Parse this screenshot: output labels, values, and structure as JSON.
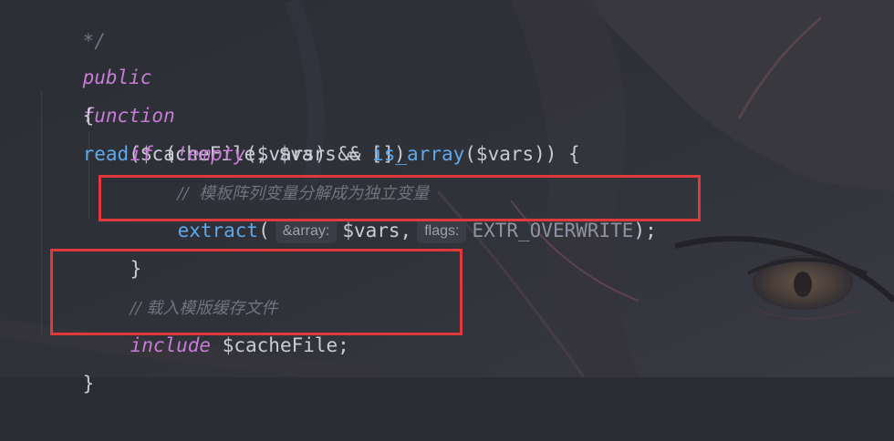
{
  "code": {
    "top_comment": "*/",
    "signature": {
      "kw_public": "public",
      "kw_function": "function",
      "fn_name": "read",
      "params": "($cacheFile, $vars = [])"
    },
    "open_brace": "{",
    "if_line": {
      "kw_if": "if",
      "paren_open": " (",
      "not": "!",
      "kw_empty": "empty",
      "arg1": "($vars) && ",
      "fn_is_array": "is_array",
      "arg2": "($vars)) {"
    },
    "comment1": "//  模板阵列变量分解成为独立变量",
    "extract_line": {
      "fn": "extract",
      "paren": "(",
      "hint1": "&array:",
      "arg1": "$vars,",
      "hint2": "flags:",
      "arg2": "EXTR_OVERWRITE",
      "end": ");"
    },
    "close_if": "}",
    "comment2": "// 载入模版缓存文件",
    "include_line": {
      "kw": "include",
      "arg": " $cacheFile;"
    },
    "close_fn": "}"
  },
  "colors": {
    "keyword": "#c77dd6",
    "function": "#5fa8ea",
    "text": "#c9ccd4",
    "comment": "#6f7480",
    "highlight_box": "#e0393b"
  }
}
